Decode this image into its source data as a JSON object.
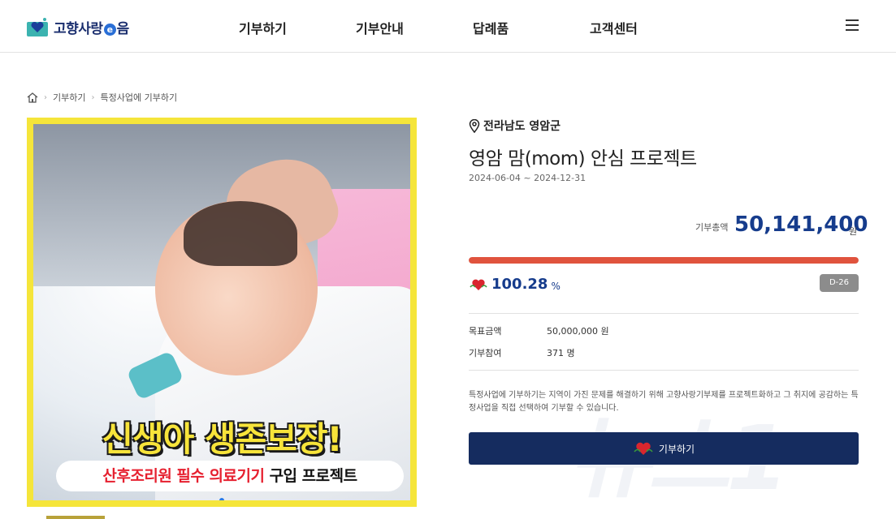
{
  "header": {
    "logo_text_a": "고향사랑",
    "logo_text_e": "e",
    "logo_text_b": "음",
    "nav": [
      "기부하기",
      "기부안내",
      "답례품",
      "고객센터"
    ]
  },
  "breadcrumb": [
    "기부하기",
    "특정사업에 기부하기"
  ],
  "hero": {
    "headline": "신생아 생존보장!",
    "sub_red": "산후조리원 필수 의료기기",
    "sub_black": "구입 프로젝트"
  },
  "project": {
    "location": "전라남도 영암군",
    "title": "영암 맘(mom) 안심 프로젝트",
    "period": "2024-06-04 ~ 2024-12-31",
    "total_label": "기부총액",
    "total_value": "50,141,400",
    "total_unit": "원",
    "percent": "100.28",
    "percent_sign": "%",
    "progress_fraction": 1.0,
    "dday": "D-26",
    "goal_label": "목표금액",
    "goal_value": "50,000,000 원",
    "participants_label": "기부참여",
    "participants_value": "371 명",
    "description": "특정사업에 기부하기는 지역이 가진 문제를 해결하기 위해 고향사랑기부제를 프로젝트화하고 그 취지에 공감하는 특정사업을 직접 선택하여 기부할 수 있습니다.",
    "donate_label": "기부하기"
  },
  "watermark": "뉴스1",
  "colors": {
    "brand": "#163c8c",
    "progress": "#e0533d",
    "button": "#152c5f",
    "hero_frame": "#f5e53a"
  }
}
